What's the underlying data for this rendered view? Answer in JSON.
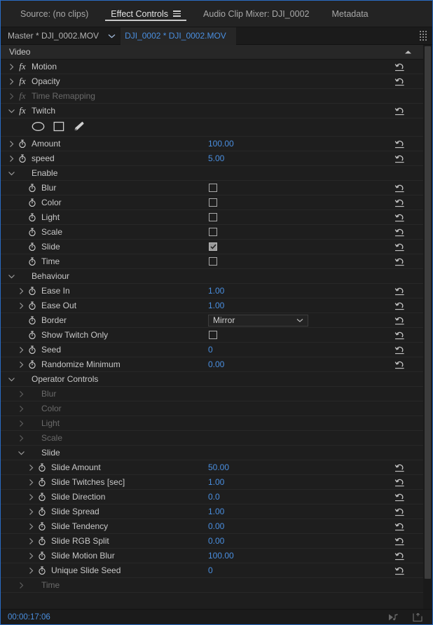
{
  "tabs": [
    {
      "label": "Source: (no clips)",
      "active": false,
      "menu": false
    },
    {
      "label": "Effect Controls",
      "active": true,
      "menu": true
    },
    {
      "label": "Audio Clip Mixer: DJI_0002",
      "active": false,
      "menu": false
    },
    {
      "label": "Metadata",
      "active": false,
      "menu": false
    }
  ],
  "clipbar": {
    "master_label": "Master * DJI_0002.MOV",
    "clip_label": "DJI_0002 * DJI_0002.MOV"
  },
  "section_header": "Video",
  "effects": [
    {
      "name": "Motion",
      "expanded": false,
      "dim": false,
      "reset": true
    },
    {
      "name": "Opacity",
      "expanded": false,
      "dim": false,
      "reset": true
    },
    {
      "name": "Time Remapping",
      "expanded": false,
      "dim": true,
      "reset": false
    },
    {
      "name": "Twitch",
      "expanded": true,
      "dim": false,
      "reset": true
    }
  ],
  "mask_tools": [
    {
      "icon": "ellipse-mask-icon"
    },
    {
      "icon": "rectangle-mask-icon"
    },
    {
      "icon": "pen-tool-icon"
    }
  ],
  "params": [
    {
      "indent": 1,
      "disclosure": "collapsed",
      "stopwatch": true,
      "label": "Amount",
      "type": "value",
      "value": "100.00",
      "reset": true,
      "dim": false
    },
    {
      "indent": 1,
      "disclosure": "collapsed",
      "stopwatch": true,
      "label": "speed",
      "type": "value",
      "value": "5.00",
      "reset": true,
      "dim": false
    },
    {
      "indent": 1,
      "disclosure": "expanded",
      "stopwatch": false,
      "label": "Enable",
      "type": "group",
      "value": "",
      "reset": false,
      "dim": false
    },
    {
      "indent": 2,
      "disclosure": "none",
      "stopwatch": true,
      "label": "Blur",
      "type": "checkbox",
      "value": false,
      "reset": true,
      "dim": false
    },
    {
      "indent": 2,
      "disclosure": "none",
      "stopwatch": true,
      "label": "Color",
      "type": "checkbox",
      "value": false,
      "reset": true,
      "dim": false
    },
    {
      "indent": 2,
      "disclosure": "none",
      "stopwatch": true,
      "label": "Light",
      "type": "checkbox",
      "value": false,
      "reset": true,
      "dim": false
    },
    {
      "indent": 2,
      "disclosure": "none",
      "stopwatch": true,
      "label": "Scale",
      "type": "checkbox",
      "value": false,
      "reset": true,
      "dim": false
    },
    {
      "indent": 2,
      "disclosure": "none",
      "stopwatch": true,
      "label": "Slide",
      "type": "checkbox",
      "value": true,
      "reset": true,
      "dim": false
    },
    {
      "indent": 2,
      "disclosure": "none",
      "stopwatch": true,
      "label": "Time",
      "type": "checkbox",
      "value": false,
      "reset": true,
      "dim": false
    },
    {
      "indent": 1,
      "disclosure": "expanded",
      "stopwatch": false,
      "label": "Behaviour",
      "type": "group",
      "value": "",
      "reset": false,
      "dim": false
    },
    {
      "indent": 2,
      "disclosure": "collapsed",
      "stopwatch": true,
      "label": "Ease In",
      "type": "value",
      "value": "1.00",
      "reset": true,
      "dim": false
    },
    {
      "indent": 2,
      "disclosure": "collapsed",
      "stopwatch": true,
      "label": "Ease Out",
      "type": "value",
      "value": "1.00",
      "reset": true,
      "dim": false
    },
    {
      "indent": 2,
      "disclosure": "none",
      "stopwatch": true,
      "label": "Border",
      "type": "dropdown",
      "value": "Mirror",
      "reset": true,
      "dim": false
    },
    {
      "indent": 2,
      "disclosure": "none",
      "stopwatch": true,
      "label": "Show Twitch Only",
      "type": "checkbox",
      "value": false,
      "reset": true,
      "dim": false
    },
    {
      "indent": 2,
      "disclosure": "collapsed",
      "stopwatch": true,
      "label": "Seed",
      "type": "value",
      "value": "0",
      "reset": true,
      "dim": false
    },
    {
      "indent": 2,
      "disclosure": "collapsed",
      "stopwatch": true,
      "label": "Randomize Minimum",
      "type": "value",
      "value": "0.00",
      "reset": true,
      "dim": false
    },
    {
      "indent": 1,
      "disclosure": "expanded",
      "stopwatch": false,
      "label": "Operator Controls",
      "type": "group",
      "value": "",
      "reset": false,
      "dim": false
    },
    {
      "indent": 2,
      "disclosure": "collapsed",
      "stopwatch": false,
      "label": "Blur",
      "type": "group",
      "value": "",
      "reset": false,
      "dim": true
    },
    {
      "indent": 2,
      "disclosure": "collapsed",
      "stopwatch": false,
      "label": "Color",
      "type": "group",
      "value": "",
      "reset": false,
      "dim": true
    },
    {
      "indent": 2,
      "disclosure": "collapsed",
      "stopwatch": false,
      "label": "Light",
      "type": "group",
      "value": "",
      "reset": false,
      "dim": true
    },
    {
      "indent": 2,
      "disclosure": "collapsed",
      "stopwatch": false,
      "label": "Scale",
      "type": "group",
      "value": "",
      "reset": false,
      "dim": true
    },
    {
      "indent": 2,
      "disclosure": "expanded",
      "stopwatch": false,
      "label": "Slide",
      "type": "group",
      "value": "",
      "reset": false,
      "dim": false
    },
    {
      "indent": 3,
      "disclosure": "collapsed",
      "stopwatch": true,
      "label": "Slide Amount",
      "type": "value",
      "value": "50.00",
      "reset": true,
      "dim": false
    },
    {
      "indent": 3,
      "disclosure": "collapsed",
      "stopwatch": true,
      "label": "Slide Twitches [sec]",
      "type": "value",
      "value": "1.00",
      "reset": true,
      "dim": false
    },
    {
      "indent": 3,
      "disclosure": "collapsed",
      "stopwatch": true,
      "label": "Slide Direction",
      "type": "value",
      "value": "0.0",
      "reset": true,
      "dim": false
    },
    {
      "indent": 3,
      "disclosure": "collapsed",
      "stopwatch": true,
      "label": "Slide Spread",
      "type": "value",
      "value": "1.00",
      "reset": true,
      "dim": false
    },
    {
      "indent": 3,
      "disclosure": "collapsed",
      "stopwatch": true,
      "label": "Slide Tendency",
      "type": "value",
      "value": "0.00",
      "reset": true,
      "dim": false
    },
    {
      "indent": 3,
      "disclosure": "collapsed",
      "stopwatch": true,
      "label": "Slide RGB Split",
      "type": "value",
      "value": "0.00",
      "reset": true,
      "dim": false
    },
    {
      "indent": 3,
      "disclosure": "collapsed",
      "stopwatch": true,
      "label": "Slide Motion Blur",
      "type": "value",
      "value": "100.00",
      "reset": true,
      "dim": false
    },
    {
      "indent": 3,
      "disclosure": "collapsed",
      "stopwatch": true,
      "label": "Unique Slide Seed",
      "type": "value",
      "value": "0",
      "reset": true,
      "dim": false
    },
    {
      "indent": 2,
      "disclosure": "collapsed",
      "stopwatch": false,
      "label": "Time",
      "type": "group",
      "value": "",
      "reset": false,
      "dim": true
    }
  ],
  "statusbar": {
    "timecode": "00:00:17:06",
    "icons": [
      "play-audio-icon",
      "export-frame-icon"
    ]
  },
  "colors": {
    "accent_blue": "#4a8fe0",
    "panel_bg": "#1e1e1e",
    "border_focus": "#2a6cc4"
  }
}
